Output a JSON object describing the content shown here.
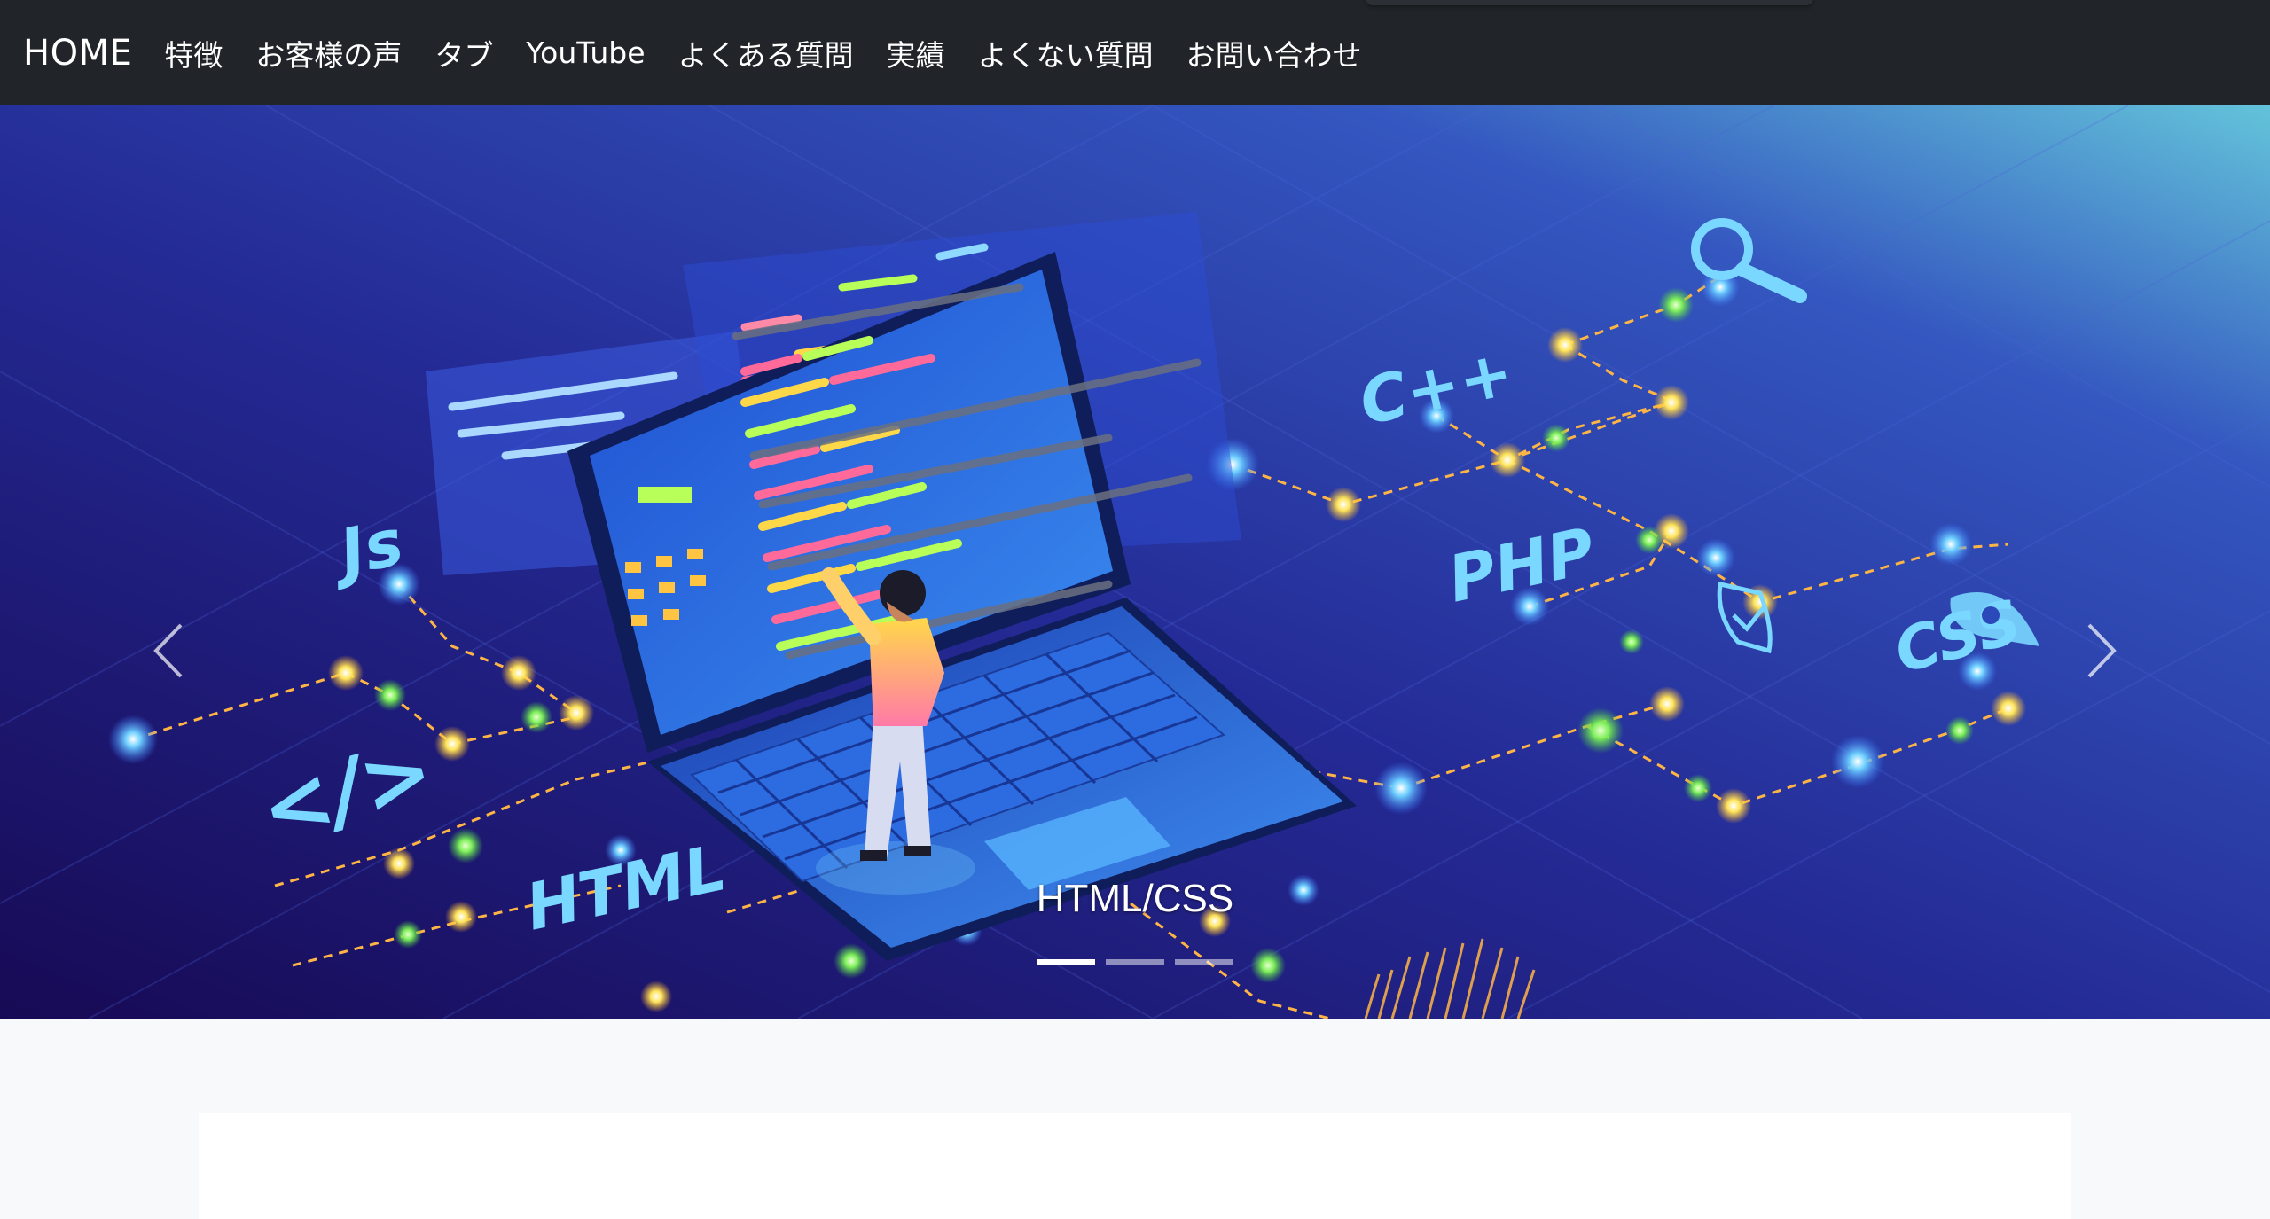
{
  "navbar": {
    "brand": "HOME",
    "links": [
      {
        "label": "特徴"
      },
      {
        "label": "お客様の声"
      },
      {
        "label": "タブ"
      },
      {
        "label": "YouTube"
      },
      {
        "label": "よくある質問"
      },
      {
        "label": "実績"
      },
      {
        "label": "よくない質問"
      },
      {
        "label": "お問い合わせ"
      }
    ],
    "background": "#212529"
  },
  "carousel": {
    "caption": "HTML/CSS",
    "slide_count": 3,
    "active_index": 0,
    "prev_icon": "chevron-left-icon",
    "next_icon": "chevron-right-icon",
    "illustration_labels": {
      "js": "Js",
      "tag": "</>",
      "html": "HTML",
      "cpp": "C++",
      "php": "PHP",
      "css": "CSS"
    },
    "colors": {
      "bg_dark": "#1a0f5e",
      "bg_mid": "#2c3ba8",
      "bg_light": "#5ab7d8",
      "accent_yellow": "#ffd84a",
      "accent_green": "#7ef05a",
      "accent_cyan": "#7ad7ff"
    }
  }
}
